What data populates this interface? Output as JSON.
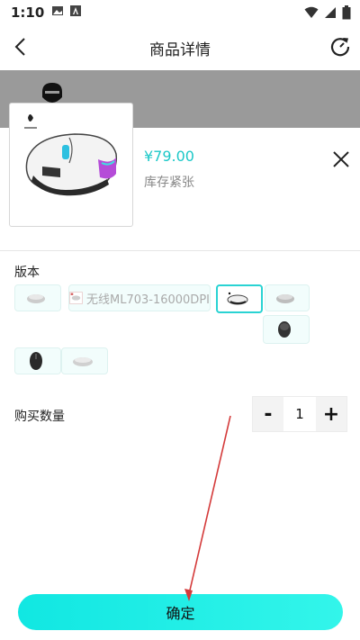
{
  "status_bar": {
    "time": "1:10"
  },
  "nav": {
    "title": "商品详情"
  },
  "product": {
    "price": "¥79.00",
    "stock": "库存紧张"
  },
  "variants": {
    "label": "版本",
    "items": [
      {
        "text": ""
      },
      {
        "text": "无线ML703-16000DPI"
      },
      {
        "text": ""
      },
      {
        "text": ""
      },
      {
        "text": ""
      },
      {
        "text": ""
      },
      {
        "text": ""
      }
    ]
  },
  "quantity": {
    "label": "购买数量",
    "minus": "-",
    "value": "1",
    "plus": "+"
  },
  "confirm_label": "确定",
  "colors": {
    "accent": "#1cc8c8",
    "button": "#11e7e2",
    "annotation_arrow": "#d43a3a"
  }
}
